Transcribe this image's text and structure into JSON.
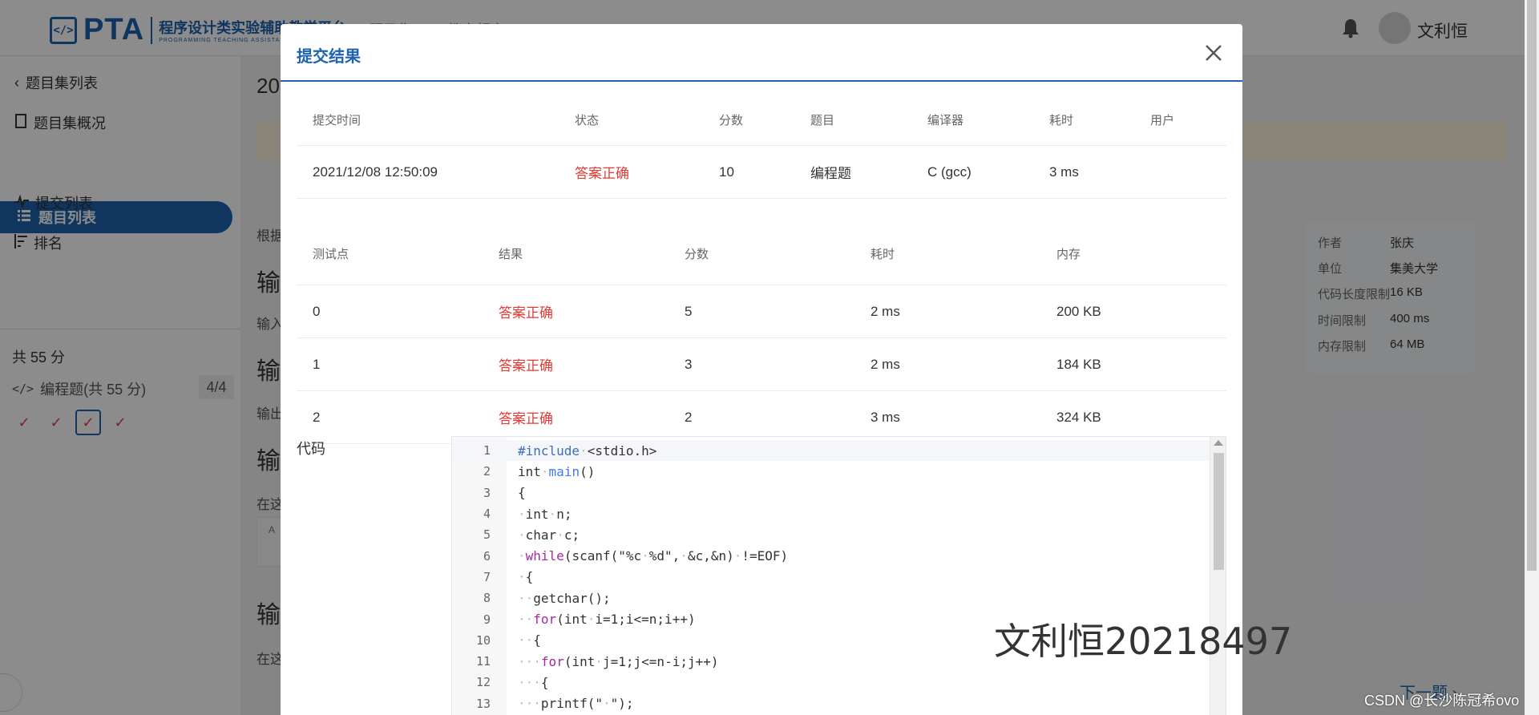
{
  "app": {
    "logo_mark": "</>",
    "logo_text": "PTA",
    "logo_subtitle": "程序设计类实验辅助教学平台",
    "logo_subtitle_en": "PROGRAMMING TEACHING ASSISTANT",
    "top_nav": [
      "题目集",
      "教育超市"
    ],
    "username": "文利恒"
  },
  "sidebar": {
    "back_label": "题目集列表",
    "items": [
      {
        "label": "题目集概况",
        "icon": "book-icon"
      },
      {
        "label": "题目列表",
        "icon": "list-icon",
        "active": true
      },
      {
        "label": "提交列表",
        "icon": "pulse-icon"
      },
      {
        "label": "排名",
        "icon": "rank-icon"
      }
    ],
    "total": "共 55 分",
    "category": "编程题(共 55 分)",
    "category_count": "4/4",
    "checks": [
      "✓",
      "✓",
      "✓",
      "✓"
    ]
  },
  "main": {
    "title": "20",
    "fragments": [
      "根据",
      "输",
      "输入",
      "输",
      "输出",
      "输",
      "在这",
      "A",
      "输",
      "在这"
    ],
    "next": "下一题"
  },
  "info": {
    "rows": [
      {
        "k": "作者",
        "v": "张庆"
      },
      {
        "k": "单位",
        "v": "集美大学"
      },
      {
        "k": "代码长度限制",
        "v": "16 KB"
      },
      {
        "k": "时间限制",
        "v": "400 ms"
      },
      {
        "k": "内存限制",
        "v": "64 MB"
      }
    ]
  },
  "modal": {
    "title": "提交结果",
    "submission": {
      "headers": [
        "提交时间",
        "状态",
        "分数",
        "题目",
        "编译器",
        "耗时",
        "用户"
      ],
      "row": [
        "2021/12/08 12:50:09",
        "答案正确",
        "10",
        "编程题",
        "C (gcc)",
        "3 ms",
        ""
      ]
    },
    "tests": {
      "headers": [
        "测试点",
        "结果",
        "分数",
        "耗时",
        "内存"
      ],
      "rows": [
        [
          "0",
          "答案正确",
          "5",
          "2 ms",
          "200 KB"
        ],
        [
          "1",
          "答案正确",
          "3",
          "2 ms",
          "184 KB"
        ],
        [
          "2",
          "答案正确",
          "2",
          "3 ms",
          "324 KB"
        ]
      ]
    },
    "code_label": "代码",
    "code_lines": [
      "#include·<stdio.h>",
      "int·main()",
      "{",
      "·int·n;",
      "·char·c;",
      "·while(scanf(\"%c·%d\",·&c,&n)·!=EOF)",
      "·{",
      "··getchar();",
      "··for(int·i=1;i<=n;i++)",
      "··{",
      "···for(int·j=1;j<=n-i;j++)",
      "···{",
      "···printf(\"·\");"
    ]
  },
  "watermarks": {
    "name": "文利恒20218497",
    "csdn": "CSDN @长沙陈冠希ovo"
  },
  "colors": {
    "primary": "#1e63b0",
    "success_red": "#e53935",
    "overlay": "rgba(0,0,0,0.45)"
  }
}
